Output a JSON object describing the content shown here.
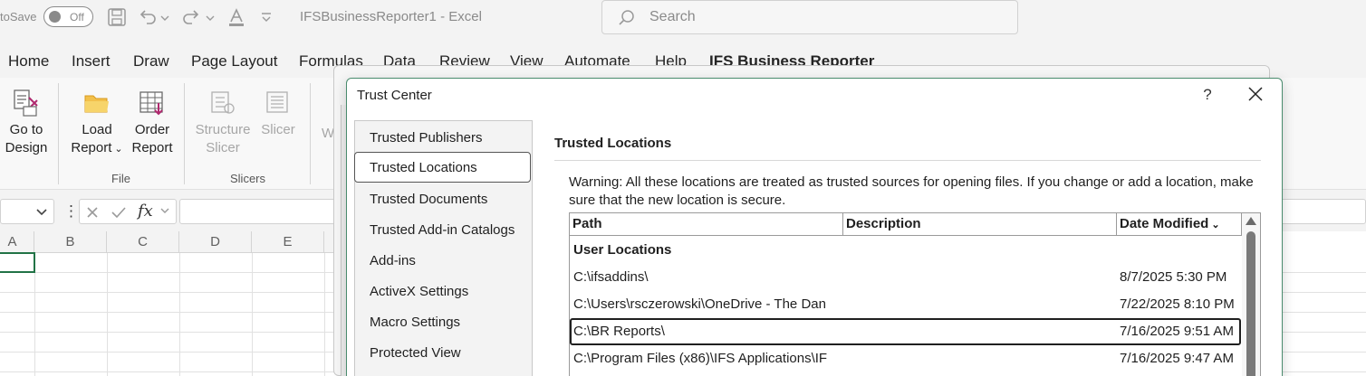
{
  "titlebar": {
    "autosave_label": "toSave",
    "autosave_state": "Off",
    "title": "IFSBusinessReporter1  -  Excel",
    "search_placeholder": "Search"
  },
  "ribbon_tabs": [
    "Home",
    "Insert",
    "Draw",
    "Page Layout",
    "Formulas",
    "Data",
    "Review",
    "View",
    "Automate",
    "Help",
    "IFS Business Reporter"
  ],
  "ribbon": {
    "go_to_design": [
      "Go to",
      "Design"
    ],
    "load_report": [
      "Load",
      "Report"
    ],
    "order_report": [
      "Order",
      "Report"
    ],
    "structure_slicer": [
      "Structure",
      "Slicer"
    ],
    "slicer": "Slicer",
    "cut_off": "W",
    "group_file": "File",
    "group_slicers": "Slicers"
  },
  "formula_bar": {
    "fx": "fx"
  },
  "grid": {
    "columns": [
      "A",
      "B",
      "C",
      "D",
      "E"
    ]
  },
  "dialog": {
    "title": "Trust Center",
    "help": "?",
    "nav": [
      "Trusted Publishers",
      "Trusted Locations",
      "Trusted Documents",
      "Trusted Add-in Catalogs",
      "Add-ins",
      "ActiveX Settings",
      "Macro Settings",
      "Protected View"
    ],
    "selected_nav": "Trusted Locations",
    "section_title": "Trusted Locations",
    "warning": "Warning: All these locations are treated as trusted sources for opening files.  If you change or add a location, make sure that the new location is secure.",
    "table": {
      "headers": [
        "Path",
        "Description",
        "Date Modified"
      ],
      "group": "User Locations",
      "rows": [
        {
          "path": "C:\\ifsaddins\\",
          "description": "",
          "date": "8/7/2025 5:30 PM"
        },
        {
          "path": "C:\\Users\\rsczerowski\\OneDrive - The Dan",
          "description": "",
          "date": "7/22/2025 8:10 PM"
        },
        {
          "path": "C:\\BR Reports\\",
          "description": "",
          "date": "7/16/2025 9:51 AM"
        },
        {
          "path": "C:\\Program Files (x86)\\IFS Applications\\IF",
          "description": "",
          "date": "7/16/2025 9:47 AM"
        }
      ],
      "selected_row": 2
    }
  }
}
